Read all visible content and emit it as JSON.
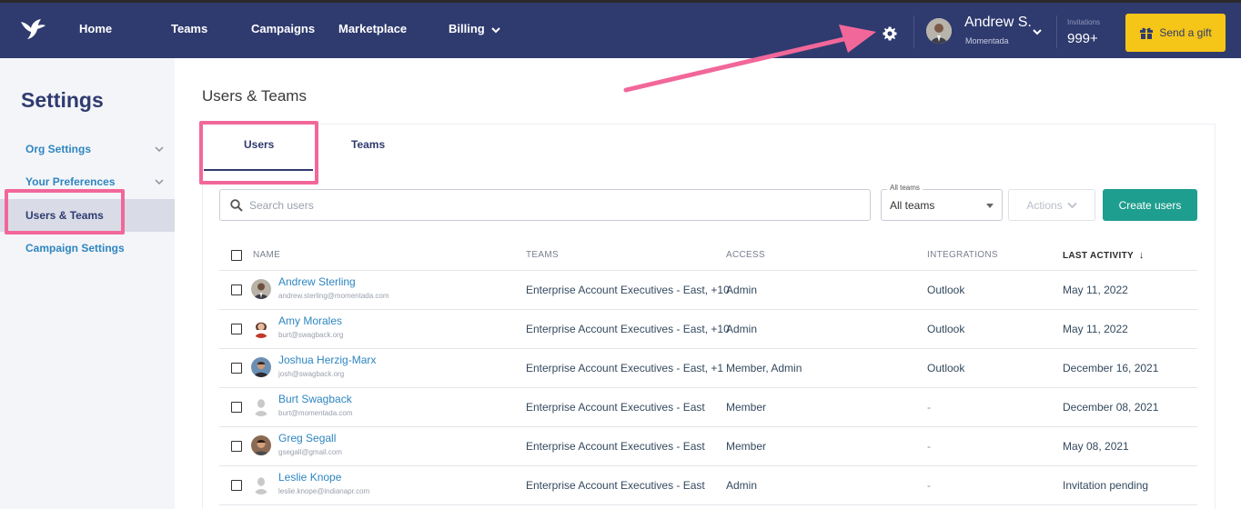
{
  "nav": {
    "items": [
      "Home",
      "Teams",
      "Campaigns",
      "Marketplace",
      "Billing"
    ],
    "user_name": "Andrew S.",
    "user_org": "Momentada",
    "invitations_label": "Invitations",
    "invitations_count": "999+",
    "gift_button": "Send a gift"
  },
  "sidebar": {
    "title": "Settings",
    "items": [
      {
        "label": "Org Settings"
      },
      {
        "label": "Your Preferences"
      },
      {
        "label": "Users & Teams"
      },
      {
        "label": "Campaign Settings"
      }
    ]
  },
  "main": {
    "title": "Users & Teams",
    "tabs": [
      "Users",
      "Teams"
    ],
    "search_placeholder": "Search users",
    "team_filter_legend": "All teams",
    "team_filter_value": "All teams",
    "actions_button": "Actions",
    "create_button": "Create users"
  },
  "table": {
    "headers": [
      "NAME",
      "TEAMS",
      "ACCESS",
      "INTEGRATIONS",
      "LAST ACTIVITY"
    ],
    "sort_indicator": "↓",
    "rows": [
      {
        "name": "Andrew Sterling",
        "email": "andrew.sterling@momentada.com",
        "teams": "Enterprise Account Executives - East, +10",
        "access": "Admin",
        "integrations": "Outlook",
        "last_activity": "May 11, 2022"
      },
      {
        "name": "Amy Morales",
        "email": "burt@swagback.org",
        "teams": "Enterprise Account Executives - East, +10",
        "access": "Admin",
        "integrations": "Outlook",
        "last_activity": "May 11, 2022"
      },
      {
        "name": "Joshua Herzig-Marx",
        "email": "josh@swagback.org",
        "teams": "Enterprise Account Executives - East, +1",
        "access": "Member, Admin",
        "integrations": "Outlook",
        "last_activity": "December 16, 2021"
      },
      {
        "name": "Burt Swagback",
        "email": "burt@momentada.com",
        "teams": "Enterprise Account Executives - East",
        "access": "Member",
        "integrations": "-",
        "last_activity": "December 08, 2021"
      },
      {
        "name": "Greg Segall",
        "email": "gsegall@gmail.com",
        "teams": "Enterprise Account Executives - East",
        "access": "Member",
        "integrations": "-",
        "last_activity": "May 08, 2021"
      },
      {
        "name": "Leslie Knope",
        "email": "leslie.knope@indianapr.com",
        "teams": "Enterprise Account Executives - East",
        "access": "Admin",
        "integrations": "-",
        "last_activity": "Invitation pending"
      }
    ]
  },
  "colors": {
    "nav_bg": "#2f3b6f",
    "accent_link": "#2e86c1",
    "gift_yellow": "#f5c518",
    "create_green": "#1e9e8e",
    "annotation_pink": "#f2679a"
  }
}
